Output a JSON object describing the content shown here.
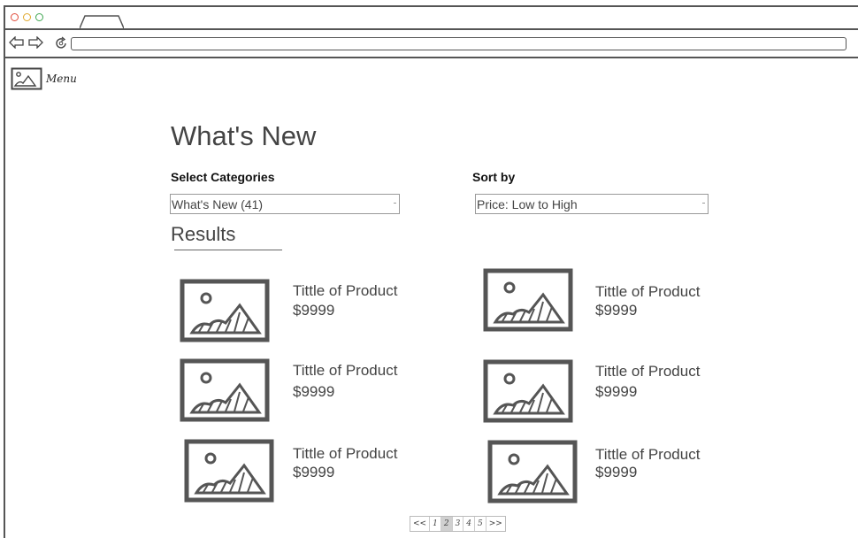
{
  "browser": {
    "window_controls": [
      "close",
      "minimize",
      "maximize"
    ],
    "colors": {
      "close": "#e04b3a",
      "minimize": "#e0a72a",
      "maximize": "#3ea650"
    },
    "url": ""
  },
  "header": {
    "menu_label": "Menu"
  },
  "page": {
    "title": "What's New",
    "categories_label": "Select Categories",
    "categories_value": "What's New (41)",
    "sort_label": "Sort by",
    "sort_value": "Price: Low to High",
    "results_label": "Results"
  },
  "products": [
    {
      "title": "Tittle of Product",
      "price": "$9999"
    },
    {
      "title": "Tittle of Product",
      "price": "$9999"
    },
    {
      "title": "Tittle of Product",
      "price": "$9999"
    },
    {
      "title": "Tittle of Product",
      "price": "$9999"
    },
    {
      "title": "Tittle of Product",
      "price": "$9999"
    },
    {
      "title": "Tittle of Product",
      "price": "$9999"
    }
  ],
  "pagination": {
    "pages": [
      "<<",
      "1",
      "2",
      "3",
      "4",
      "5",
      ">>"
    ],
    "current": "2"
  }
}
